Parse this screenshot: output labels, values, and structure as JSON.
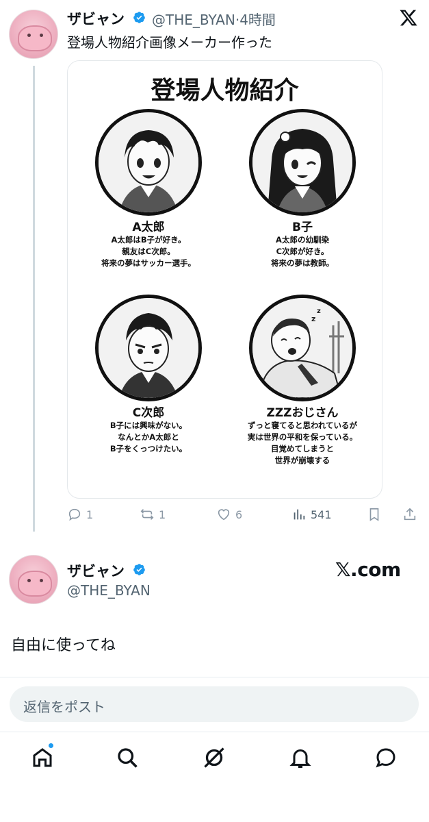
{
  "tweet": {
    "author_name": "ザビャン",
    "author_handle": "@THE_BYAN",
    "separator": "·",
    "time": "4時間",
    "text": "登場人物紹介画像メーカー作った",
    "image": {
      "title": "登場人物紹介",
      "characters": [
        {
          "name": "A太郎",
          "lines": [
            "A太郎はB子が好き。",
            "親友はC次郎。",
            "将来の夢はサッカー選手。"
          ]
        },
        {
          "name": "B子",
          "lines": [
            "A太郎の幼馴染",
            "C次郎が好き。",
            "将来の夢は教師。"
          ]
        },
        {
          "name": "C次郎",
          "lines": [
            "B子には興味がない。",
            "なんとかA太郎と",
            "B子をくっつけたい。"
          ]
        },
        {
          "name": "ZZZおじさん",
          "lines": [
            "ずっと寝てると思われているが",
            "実は世界の平和を保っている。",
            "目覚めてしまうと",
            "世界が崩壊する"
          ]
        }
      ]
    },
    "actions": {
      "replies": "1",
      "reposts": "1",
      "likes": "6",
      "views": "541"
    }
  },
  "reply_tweet": {
    "author_name": "ザビャン",
    "author_handle": "@THE_BYAN",
    "brand": "𝕏.com",
    "text": "自由に使ってね"
  },
  "composer": {
    "placeholder": "返信をポスト"
  },
  "icons": {
    "header": "x-logo-icon",
    "tabs": [
      "home-icon",
      "search-icon",
      "grok-icon",
      "notifications-icon",
      "messages-icon"
    ]
  },
  "colors": {
    "verified": "#1d9bf0",
    "notification_dot": "#1d9bf0",
    "secondary_text": "#536471"
  }
}
